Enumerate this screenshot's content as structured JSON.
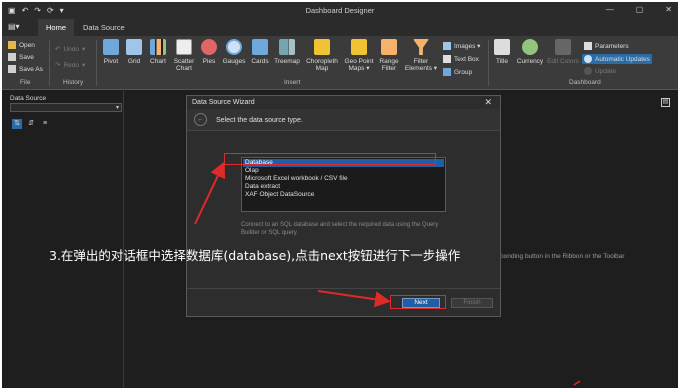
{
  "window": {
    "title": "Dashboard Designer",
    "quick_access": [
      "▣",
      "↶",
      "↷",
      "⟳",
      "▾"
    ],
    "controls": [
      "—",
      "▢",
      "✕"
    ]
  },
  "tabs": [
    {
      "label": "Home",
      "active": true
    },
    {
      "label": "Data Source",
      "active": false
    }
  ],
  "ribbon": {
    "file_group": {
      "open": "Open",
      "save": "Save",
      "save_as": "Save As",
      "label": "File"
    },
    "history_group": {
      "undo": "Undo",
      "redo": "Redo",
      "label": "History"
    },
    "insert_items": [
      {
        "label": "Pivot",
        "icon": "pivot-icon",
        "color": "#6fa8dc"
      },
      {
        "label": "Grid",
        "icon": "grid-icon",
        "color": "#9fc5e8"
      },
      {
        "label": "Chart",
        "icon": "chart-icon",
        "color": "#f6b26b"
      },
      {
        "label": "Scatter\nChart",
        "icon": "scatter-chart-icon",
        "color": "#e06666"
      },
      {
        "label": "Pies",
        "icon": "pie-icon",
        "color": "#e06666"
      },
      {
        "label": "Gauges",
        "icon": "gauge-icon",
        "color": "#6fa8dc"
      },
      {
        "label": "Cards",
        "icon": "cards-icon",
        "color": "#6fa8dc"
      },
      {
        "label": "Treemap",
        "icon": "treemap-icon",
        "color": "#76a5af"
      },
      {
        "label": "Choropleth\nMap",
        "icon": "choropleth-map-icon",
        "color": "#f1c232"
      },
      {
        "label": "Geo Point\nMaps ▾",
        "icon": "geo-point-map-icon",
        "color": "#f1c232"
      },
      {
        "label": "Range\nFilter",
        "icon": "range-filter-icon",
        "color": "#f6b26b"
      },
      {
        "label": "Filter\nElements ▾",
        "icon": "filter-elements-icon",
        "color": "#f6b26b"
      }
    ],
    "insert_small": [
      "Images ▾",
      "Text Box",
      "Group"
    ],
    "insert_label": "Insert",
    "dashboard_items": [
      {
        "label": "Title",
        "icon": "title-icon"
      },
      {
        "label": "Currency",
        "icon": "currency-icon"
      },
      {
        "label": "Edit Colors",
        "icon": "edit-colors-icon",
        "disabled": true
      }
    ],
    "dashboard_small": [
      {
        "label": "Parameters",
        "highlight": false,
        "disabled": false
      },
      {
        "label": "Automatic Updates",
        "highlight": true,
        "disabled": false
      },
      {
        "label": "Update",
        "highlight": false,
        "disabled": true
      }
    ],
    "dashboard_label": "Dashboard"
  },
  "left_panel": {
    "label": "Data Source",
    "select_value": ""
  },
  "canvas_hint": "ponding button in the Ribbon or the Toolbar",
  "dialog": {
    "title": "Data Source Wizard",
    "close": "✕",
    "prompt": "Select the data source type.",
    "options": [
      "Database",
      "Olap",
      "Microsoft Excel workbook / CSV file",
      "Data extract",
      "XAF Object DataSource"
    ],
    "selected_index": 0,
    "description": "Connect to an SQL database and select the required data using the Query Builder or SQL query.",
    "next_label": "Next",
    "finish_label": "Finish"
  },
  "annotation": {
    "caption": "3.在弹出的对话框中选择数据库(database),点击next按钮进行下一步操作",
    "color": "#e02a2a"
  }
}
